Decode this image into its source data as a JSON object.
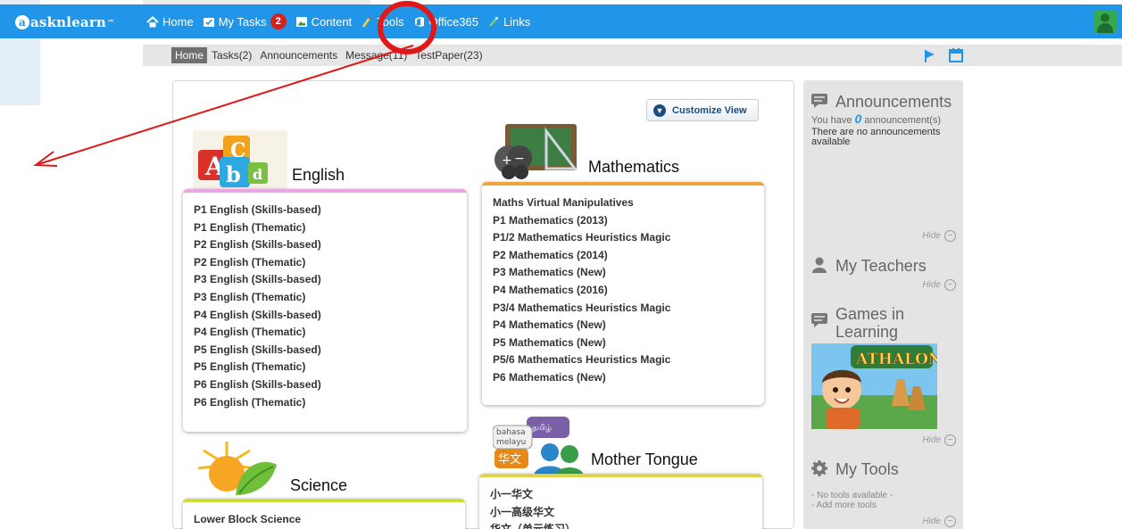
{
  "app": {
    "logo_text": "asknlearn",
    "logo_tm": "™"
  },
  "nav": {
    "items": [
      {
        "label": "Home",
        "icon": "home-icon"
      },
      {
        "label": "My Tasks",
        "icon": "tasks-icon",
        "count": "2"
      },
      {
        "label": "Content",
        "icon": "content-icon"
      },
      {
        "label": "Tools",
        "icon": "tools-icon"
      },
      {
        "label": "Office365",
        "icon": "office365-icon"
      },
      {
        "label": "Links",
        "icon": "links-icon"
      }
    ]
  },
  "subnav": {
    "tabs": [
      {
        "label": "Home",
        "active": true
      },
      {
        "label": "Tasks(2)"
      },
      {
        "label": "Announcements"
      },
      {
        "label": "Message(11)"
      },
      {
        "label": "TestPaper(23)"
      }
    ]
  },
  "main": {
    "customize_label": "Customize View",
    "subjects": {
      "english": {
        "title": "English",
        "courses": [
          "P1 English (Skills-based)",
          "P1 English (Thematic)",
          "P2 English (Skills-based)",
          "P2 English (Thematic)",
          "P3 English (Skills-based)",
          "P3 English (Thematic)",
          "P4 English (Skills-based)",
          "P4 English (Thematic)",
          "P5 English (Skills-based)",
          "P5 English (Thematic)",
          "P6 English (Skills-based)",
          "P6 English (Thematic)"
        ]
      },
      "math": {
        "title": "Mathematics",
        "courses": [
          "Maths Virtual Manipulatives",
          "P1 Mathematics (2013)",
          "P1/2 Mathematics Heuristics Magic",
          "P2 Mathematics (2014)",
          "P3 Mathematics (New)",
          "P4 Mathematics (2016)",
          "P3/4 Mathematics Heuristics Magic",
          "P4 Mathematics (New)",
          "P5 Mathematics (New)",
          "P5/6 Mathematics Heuristics Magic",
          "P6 Mathematics (New)"
        ]
      },
      "science": {
        "title": "Science",
        "courses": [
          "Lower Block Science"
        ]
      },
      "mother_tongue": {
        "title": "Mother Tongue",
        "icon_words": [
          "bahasa",
          "melayu",
          "தமிழ்",
          "华文"
        ],
        "courses": [
          "小一华文",
          "小一高级华文",
          "华文（单元练习）"
        ]
      }
    }
  },
  "sidebar": {
    "announcements": {
      "title": "Announcements",
      "count_prefix": "You have",
      "count": "0",
      "count_suffix": "announcement(s)",
      "empty_text": "There are no announcements available",
      "hide_label": "Hide"
    },
    "teachers": {
      "title": "My Teachers",
      "hide_label": "Hide"
    },
    "games": {
      "title": "Games in Learning",
      "image_caption": "ATHALON",
      "hide_label": "Hide"
    },
    "tools": {
      "title": "My Tools",
      "line1": "- No tools available -",
      "line2": "- Add more tools",
      "hide_label": "Hide"
    }
  },
  "colors": {
    "nav_blue": "#2196e8",
    "count_red": "#d3231f",
    "annotation_red": "#e01818",
    "english_accent": "#e8a6e3",
    "math_accent": "#f0a33c",
    "science_accent": "#cddc39",
    "mt_accent": "#e2d24a"
  }
}
